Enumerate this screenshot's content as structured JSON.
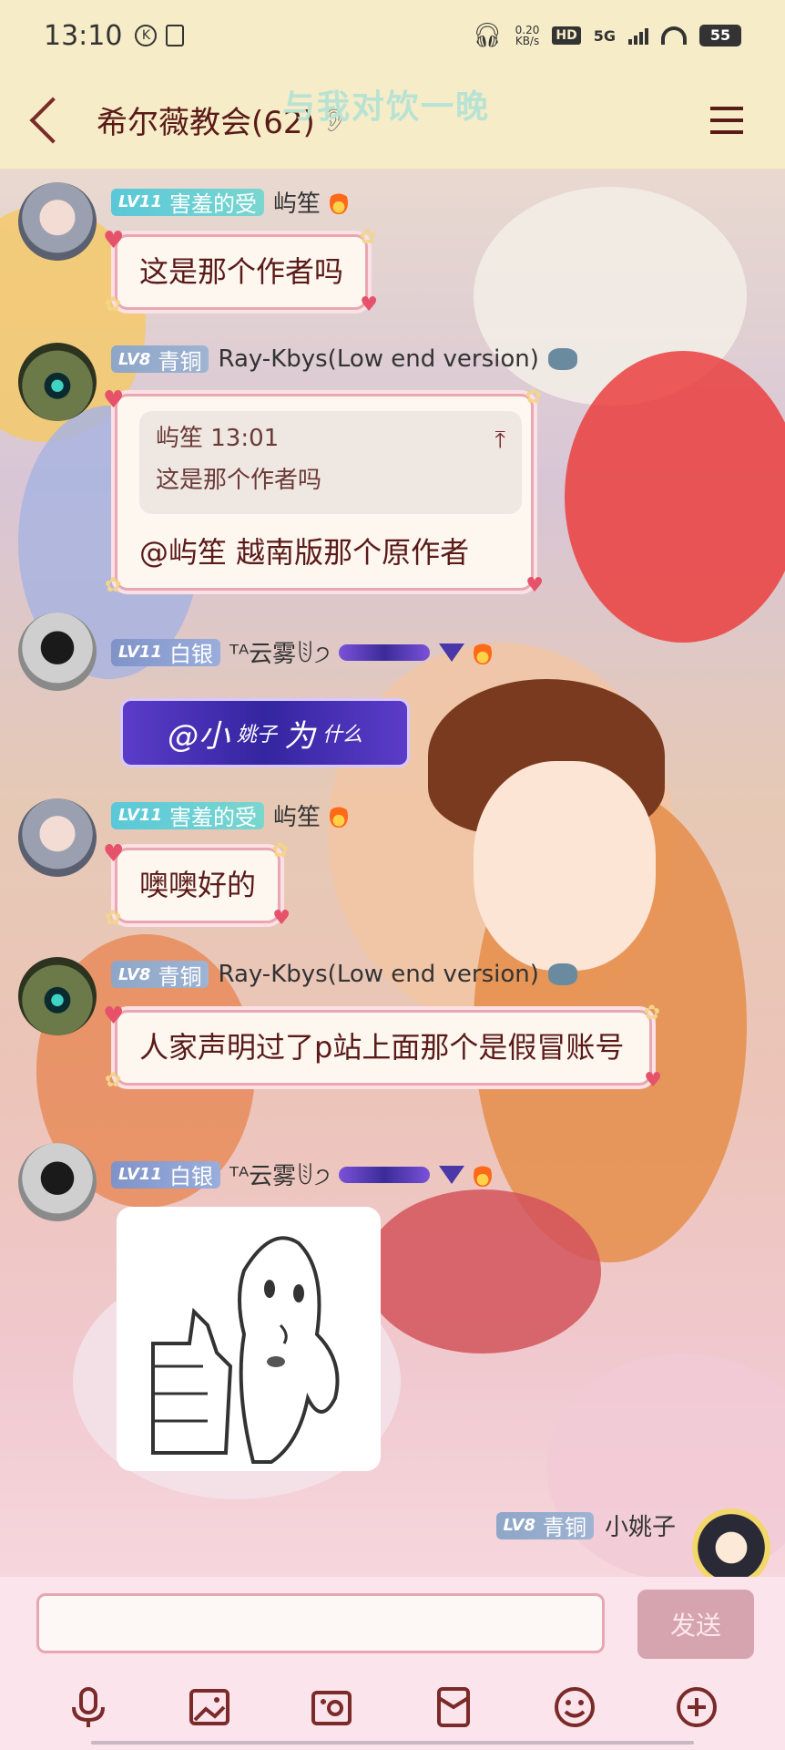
{
  "status_bar": {
    "time": "13:10",
    "net_speed_value": "0.20",
    "net_speed_unit": "KB/s",
    "hd": "HD",
    "network": "5G",
    "battery": "55"
  },
  "header": {
    "title": "希尔薇教会(62)",
    "banner": "与我对饮一晚"
  },
  "messages": [
    {
      "level": "LV11",
      "rank": "害羞的受",
      "user": "屿笙",
      "text": "这是那个作者吗"
    },
    {
      "level": "LV8",
      "rank": "青铜",
      "user": "Ray-Kbys(Low end version)",
      "quote_head": "屿笙 13:01",
      "quote_text": "这是那个作者吗",
      "text": "@屿笙 越南版那个原作者"
    },
    {
      "level": "LV11",
      "rank": "白银",
      "user": "ᵀᴬ云雾ꂹ੭",
      "purple_text_a": "@小",
      "purple_text_b": "姚子",
      "purple_text_c": "为",
      "purple_text_d": "什么"
    },
    {
      "level": "LV11",
      "rank": "害羞的受",
      "user": "屿笙",
      "text": "噢噢好的"
    },
    {
      "level": "LV8",
      "rank": "青铜",
      "user": "Ray-Kbys(Low end version)",
      "text": "人家声明过了p站上面那个是假冒账号"
    },
    {
      "level": "LV11",
      "rank": "白银",
      "user": "ᵀᴬ云雾ꂹ੭"
    }
  ],
  "my_message": {
    "level": "LV8",
    "rank": "青铜",
    "user": "小姚子"
  },
  "input": {
    "placeholder": "",
    "send_label": "发送"
  },
  "toolbar": [
    "microphone-icon",
    "image-icon",
    "camera-icon",
    "red-packet-icon",
    "emoji-icon",
    "plus-icon"
  ],
  "colors": {
    "header_bg": "#f6ecc8",
    "bubble_border": "#e8a7b3",
    "text_dark_red": "#5a1a18",
    "send_button": "#d6a4ae"
  }
}
